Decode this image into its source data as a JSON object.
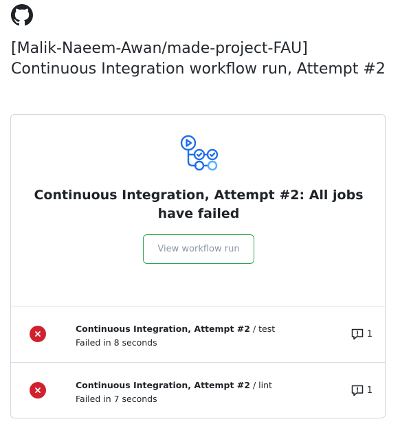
{
  "header": {
    "title": "[Malik-Naeem-Awan/made-project-FAU] Continuous Integration workflow run, Attempt #2"
  },
  "card": {
    "headline": "Continuous Integration, Attempt #2: All jobs have failed",
    "button_label": "View workflow run"
  },
  "jobs": [
    {
      "workflow": "Continuous Integration, Attempt #2",
      "separator": " / ",
      "job": "test",
      "status": "Failed in 8 seconds",
      "annotation_count": "1"
    },
    {
      "workflow": "Continuous Integration, Attempt #2",
      "separator": " / ",
      "job": "lint",
      "status": "Failed in 7 seconds",
      "annotation_count": "1"
    }
  ],
  "icons": {
    "logo": "github-logo",
    "workflow": "workflow-icon",
    "failure": "x-circle-icon",
    "annotation": "comment-alert-icon"
  },
  "colors": {
    "failure": "#cf222e",
    "button_border": "#2da44e",
    "workflow_icon_stroke": "#1f6feb",
    "workflow_icon_pending": "#54aeff",
    "text": "#1f2328",
    "muted": "#8c959f",
    "border": "#d0d7de"
  }
}
